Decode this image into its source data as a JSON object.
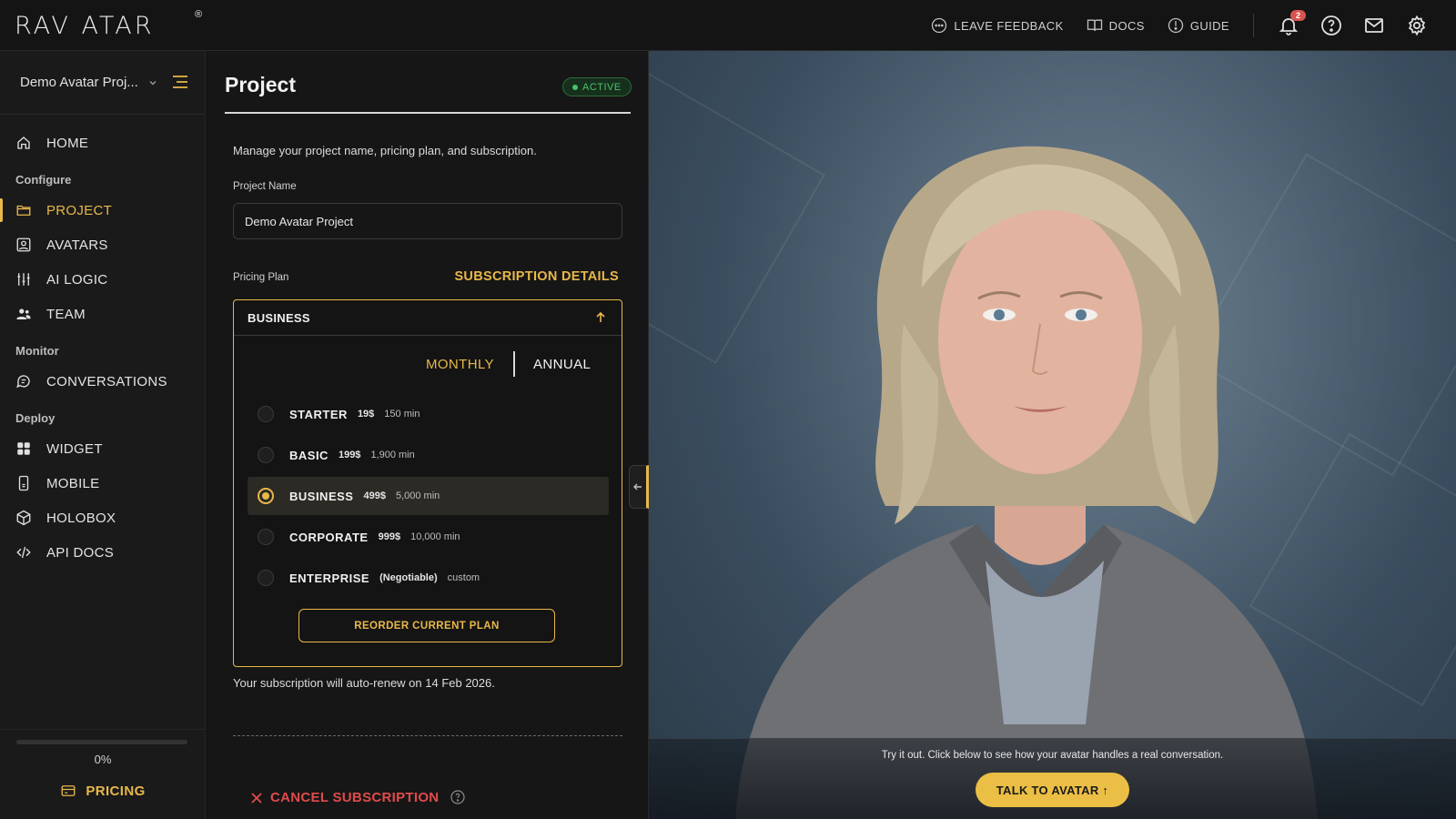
{
  "app": {
    "logo_text": "RAVATAR",
    "logo_mark": "®"
  },
  "topbar": {
    "feedback_label": "LEAVE FEEDBACK",
    "docs_label": "DOCS",
    "guide_label": "GUIDE",
    "notification_count": "2",
    "icons": [
      "chat-icon",
      "book-icon",
      "compass-icon",
      "bell-icon",
      "help-icon",
      "mail-icon",
      "gear-icon"
    ]
  },
  "sidebar": {
    "project_selector": "Demo Avatar Proj...",
    "items": [
      {
        "label": "HOME",
        "icon": "home-icon"
      },
      {
        "section": "Configure"
      },
      {
        "label": "PROJECT",
        "icon": "folder-icon",
        "active": true
      },
      {
        "label": "AVATARS",
        "icon": "avatar-icon"
      },
      {
        "label": "AI LOGIC",
        "icon": "sliders-icon"
      },
      {
        "label": "TEAM",
        "icon": "team-icon"
      },
      {
        "section": "Monitor"
      },
      {
        "label": "CONVERSATIONS",
        "icon": "chat-bubble-icon"
      },
      {
        "section": "Deploy"
      },
      {
        "label": "WIDGET",
        "icon": "grid-icon"
      },
      {
        "label": "MOBILE",
        "icon": "phone-icon"
      },
      {
        "label": "HOLOBOX",
        "icon": "cube-icon"
      },
      {
        "label": "API DOCS",
        "icon": "code-icon"
      }
    ],
    "section_configure": "Configure",
    "section_monitor": "Monitor",
    "section_deploy": "Deploy",
    "labels": {
      "home": "HOME",
      "project": "PROJECT",
      "avatars": "AVATARS",
      "ai_logic": "AI LOGIC",
      "team": "TEAM",
      "conversations": "CONVERSATIONS",
      "widget": "WIDGET",
      "mobile": "MOBILE",
      "holobox": "HOLOBOX",
      "api_docs": "API DOCS"
    },
    "usage_progress": 0,
    "usage_text": "0%",
    "pricing_label": "PRICING"
  },
  "project": {
    "title": "Project",
    "status": "ACTIVE",
    "description": "Manage your project name, pricing plan, and subscription.",
    "name_label": "Project Name",
    "name_value": "Demo Avatar Project",
    "plan_label": "Pricing Plan",
    "subscription_details": "SUBSCRIPTION DETAILS",
    "current_plan": "BUSINESS",
    "billing": {
      "monthly": "MONTHLY",
      "annual": "ANNUAL",
      "selected": "MONTHLY"
    },
    "plans": [
      {
        "name": "STARTER",
        "price": "19$",
        "minutes": "150 min",
        "selected": false
      },
      {
        "name": "BASIC",
        "price": "199$",
        "minutes": "1,900 min",
        "selected": false
      },
      {
        "name": "BUSINESS",
        "price": "499$",
        "minutes": "5,000 min",
        "selected": true
      },
      {
        "name": "CORPORATE",
        "price": "999$",
        "minutes": "10,000 min",
        "selected": false
      },
      {
        "name": "ENTERPRISE",
        "price": "(Negotiable)",
        "minutes": "custom",
        "selected": false
      }
    ],
    "reorder_label": "REORDER CURRENT PLAN",
    "renew_text": "Your subscription will auto-renew on 14 Feb 2026.",
    "cancel_label": "CANCEL SUBSCRIPTION"
  },
  "stage": {
    "try_text": "Try it out. Click below to see how your avatar handles a real conversation.",
    "talk_label": "TALK TO AVATAR ↑"
  },
  "colors": {
    "accent": "#e8b84a",
    "active_green": "#4cc26a",
    "danger": "#e04b4b",
    "background": "#141414"
  }
}
